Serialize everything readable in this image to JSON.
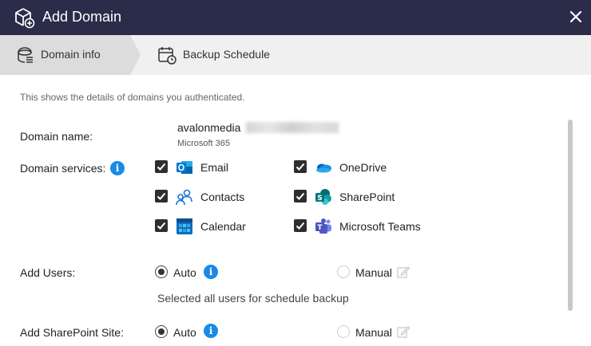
{
  "titlebar": {
    "title": "Add Domain",
    "close_icon": "close-icon",
    "logo_icon": "cube-add-icon"
  },
  "steps": [
    {
      "label": "Domain info",
      "active": true,
      "icon": "domain-icon"
    },
    {
      "label": "Backup Schedule",
      "active": false,
      "icon": "calendar-clock-icon"
    }
  ],
  "description": "This shows the details of domains you authenticated.",
  "domain": {
    "label": "Domain name:",
    "value": "avalonmedia",
    "subtitle": "Microsoft 365"
  },
  "services": {
    "label": "Domain services:",
    "items": [
      {
        "name": "Email",
        "checked": true,
        "icon": "outlook-icon"
      },
      {
        "name": "OneDrive",
        "checked": true,
        "icon": "onedrive-icon"
      },
      {
        "name": "Contacts",
        "checked": true,
        "icon": "contacts-icon"
      },
      {
        "name": "SharePoint",
        "checked": true,
        "icon": "sharepoint-icon"
      },
      {
        "name": "Calendar",
        "checked": true,
        "icon": "calendar-icon"
      },
      {
        "name": "Microsoft Teams",
        "checked": true,
        "icon": "teams-icon"
      }
    ]
  },
  "add_users": {
    "label": "Add Users:",
    "auto": "Auto",
    "manual": "Manual",
    "selected": "Auto",
    "note": "Selected all users for schedule backup"
  },
  "add_sharepoint": {
    "label": "Add SharePoint Site:",
    "auto": "Auto",
    "manual": "Manual",
    "selected": "Auto"
  },
  "colors": {
    "titlebar": "#2b2b4a",
    "active_step": "#dcdcdc",
    "info": "#1a8ae6",
    "checkbox": "#2e2e2e"
  }
}
